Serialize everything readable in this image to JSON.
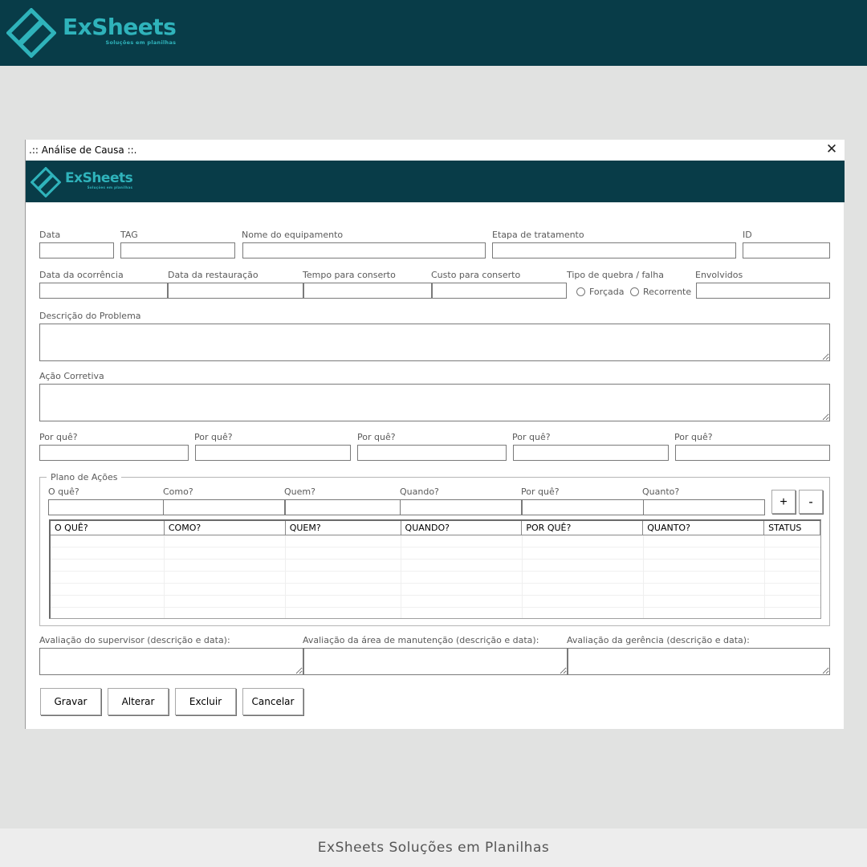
{
  "brand": {
    "name": "ExSheets",
    "tagline": "Soluções em planilhas"
  },
  "window": {
    "title": ".:: Análise de Causa ::.",
    "close_glyph": "✕"
  },
  "row1": {
    "data": "Data",
    "tag": "TAG",
    "nome": "Nome do equipamento",
    "etapa": "Etapa de tratamento",
    "id": "ID"
  },
  "row2": {
    "data_ocorrencia": "Data da ocorrência",
    "data_restauracao": "Data da restauração",
    "tempo": "Tempo para conserto",
    "custo": "Custo para conserto",
    "tipo": "Tipo de quebra / falha",
    "forcada": "Forçada",
    "recorrente": "Recorrente",
    "envolvidos": "Envolvidos"
  },
  "descricao": "Descrição do Problema",
  "acao": "Ação Corretiva",
  "porques": [
    "Por quê?",
    "Por quê?",
    "Por quê?",
    "Por quê?",
    "Por quê?"
  ],
  "plano": {
    "title": "Plano de Ações",
    "labels": [
      "O quê?",
      "Como?",
      "Quem?",
      "Quando?",
      "Por quê?",
      "Quanto?"
    ],
    "add": "+",
    "remove": "-",
    "columns": [
      "O QUÊ?",
      "COMO?",
      "QUEM?",
      "QUANDO?",
      "POR QUÊ?",
      "QUANTO?",
      "STATUS"
    ]
  },
  "avaliacoes": {
    "supervisor": "Avaliação do supervisor (descrição e data):",
    "manutencao": "Avaliação da área de manutenção (descrição e data):",
    "gerencia": "Avaliação da gerência (descrição e data):"
  },
  "buttons": {
    "gravar": "Gravar",
    "alterar": "Alterar",
    "excluir": "Excluir",
    "cancelar": "Cancelar"
  },
  "footer": "ExSheets Soluções em Planilhas",
  "colors": {
    "banner": "#083c48",
    "brand": "#2fb3bb",
    "background": "#e1e2e1"
  },
  "icons": {
    "logo": "exsheets-logo-icon",
    "close": "close-icon"
  }
}
